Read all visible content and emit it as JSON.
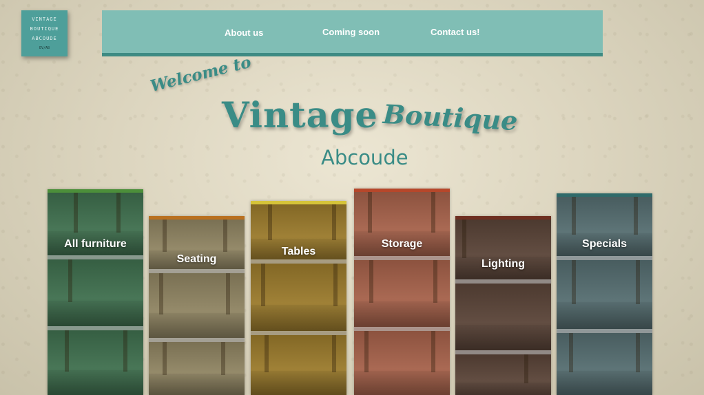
{
  "logo": {
    "line1": "VINTAGE",
    "line2": "BOUTIQUE",
    "line3": "ABCOUDE",
    "line4": "EV/AB"
  },
  "nav": {
    "about": "About us",
    "coming": "Coming soon",
    "contact": "Contact us!"
  },
  "hero": {
    "welcome": "Welcome to",
    "title": "Vintage",
    "title_script": "Boutique",
    "subtitle": "Abcoude"
  },
  "categories": [
    {
      "label": "All furniture",
      "color": "#3f6f4e",
      "accent": "#4c8f3a"
    },
    {
      "label": "Seating",
      "color": "#8f8462",
      "accent": "#b9701f"
    },
    {
      "label": "Tables",
      "color": "#9a7a2c",
      "accent": "#d6c43a"
    },
    {
      "label": "Storage",
      "color": "#a5614a",
      "accent": "#b6472a"
    },
    {
      "label": "Lighting",
      "color": "#5a4438",
      "accent": "#6e2f20"
    },
    {
      "label": "Specials",
      "color": "#556d70",
      "accent": "#2f6a6a"
    }
  ]
}
